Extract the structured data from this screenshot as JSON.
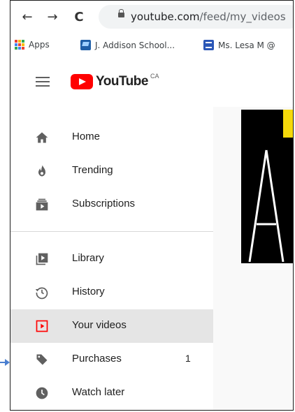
{
  "browser": {
    "url_host": "youtube.com",
    "url_path": "/feed/my_videos",
    "nav": {
      "back_glyph": "←",
      "forward_glyph": "→",
      "reload_glyph": "C"
    },
    "bookmarks": [
      {
        "label": "Apps"
      },
      {
        "label": "J. Addison School..."
      },
      {
        "label": "Ms. Lesa M @"
      }
    ]
  },
  "youtube": {
    "logo_text": "YouTube",
    "region": "CA"
  },
  "sidebar": {
    "items": [
      {
        "label": "Home",
        "icon": "home-icon"
      },
      {
        "label": "Trending",
        "icon": "trending-icon"
      },
      {
        "label": "Subscriptions",
        "icon": "subscriptions-icon"
      },
      {
        "label": "Library",
        "icon": "library-icon"
      },
      {
        "label": "History",
        "icon": "history-icon"
      },
      {
        "label": "Your videos",
        "icon": "your-videos-icon",
        "active": true
      },
      {
        "label": "Purchases",
        "icon": "purchases-icon",
        "count": "1"
      },
      {
        "label": "Watch later",
        "icon": "watch-later-icon"
      }
    ]
  },
  "colors": {
    "brand": "#ff0000",
    "active_bg": "#e5e5e5",
    "annotation_arrow": "#4a7fd0"
  }
}
